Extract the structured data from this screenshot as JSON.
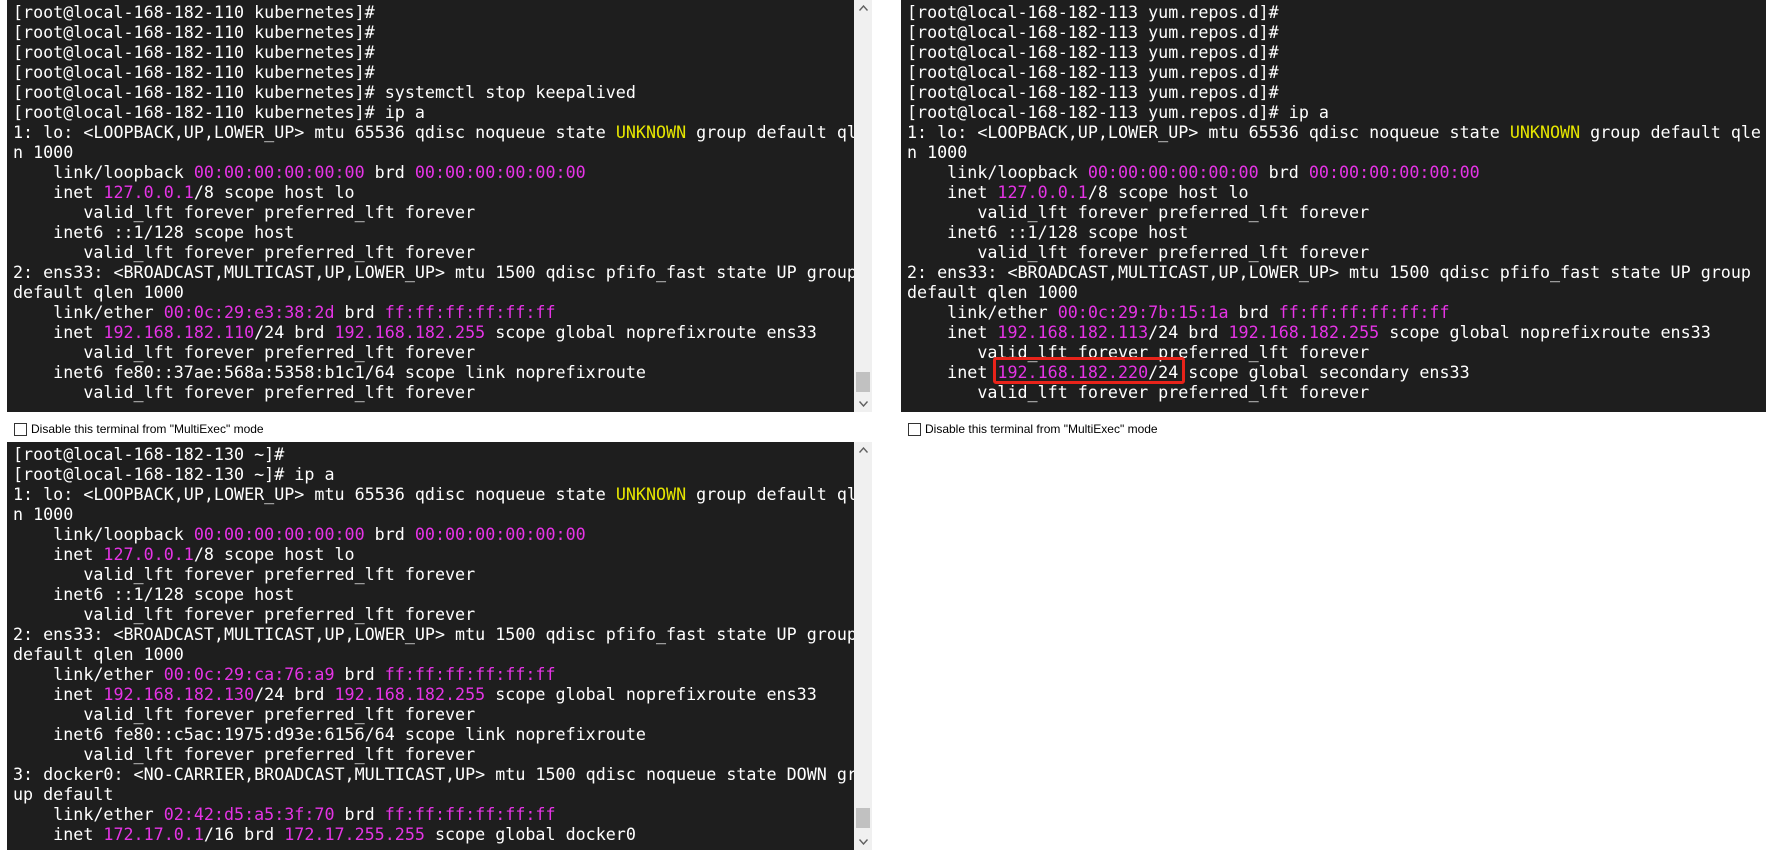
{
  "colors": {
    "terminal_bg": "#1e1e1e",
    "text": "#ffffff",
    "magenta": "#e534e5",
    "yellow": "#e5e500",
    "highlight": "#e8231a"
  },
  "terminals": [
    {
      "id": "top-left",
      "lines": [
        [
          {
            "t": "[root@local-168-182-110 kubernetes]#"
          }
        ],
        [
          {
            "t": "[root@local-168-182-110 kubernetes]#"
          }
        ],
        [
          {
            "t": "[root@local-168-182-110 kubernetes]#"
          }
        ],
        [
          {
            "t": "[root@local-168-182-110 kubernetes]#"
          }
        ],
        [
          {
            "t": "[root@local-168-182-110 kubernetes]# systemctl stop keepalived"
          }
        ],
        [
          {
            "t": "[root@local-168-182-110 kubernetes]# ip a"
          }
        ],
        [
          {
            "t": "1: lo: <LOOPBACK,UP,LOWER_UP> mtu 65536 qdisc noqueue state "
          },
          {
            "t": "UNKNOWN",
            "c": "yel"
          },
          {
            "t": " group default qle"
          }
        ],
        [
          {
            "t": "n 1000"
          }
        ],
        [
          {
            "t": "    link/loopback "
          },
          {
            "t": "00:00:00:00:00:00",
            "c": "mag"
          },
          {
            "t": " brd "
          },
          {
            "t": "00:00:00:00:00:00",
            "c": "mag"
          }
        ],
        [
          {
            "t": "    inet "
          },
          {
            "t": "127.0.0.1",
            "c": "mag"
          },
          {
            "t": "/8 scope host lo"
          }
        ],
        [
          {
            "t": "       valid_lft forever preferred_lft forever"
          }
        ],
        [
          {
            "t": "    inet6 ::1/128 scope host"
          }
        ],
        [
          {
            "t": "       valid_lft forever preferred_lft forever"
          }
        ],
        [
          {
            "t": "2: ens33: <BROADCAST,MULTICAST,UP,LOWER_UP> mtu 1500 qdisc pfifo_fast state UP group"
          }
        ],
        [
          {
            "t": "default qlen 1000"
          }
        ],
        [
          {
            "t": "    link/ether "
          },
          {
            "t": "00:0c:29:e3:38:2d",
            "c": "mag"
          },
          {
            "t": " brd "
          },
          {
            "t": "ff:ff:ff:ff:ff:ff",
            "c": "mag"
          }
        ],
        [
          {
            "t": "    inet "
          },
          {
            "t": "192.168.182.110",
            "c": "mag"
          },
          {
            "t": "/24 brd "
          },
          {
            "t": "192.168.182.255",
            "c": "mag"
          },
          {
            "t": " scope global noprefixroute ens33"
          }
        ],
        [
          {
            "t": "       valid_lft forever preferred_lft forever"
          }
        ],
        [
          {
            "t": "    inet6 fe80::37ae:568a:5358:b1c1/64 scope link noprefixroute"
          }
        ],
        [
          {
            "t": "       valid_lft forever preferred_lft forever"
          }
        ]
      ]
    },
    {
      "id": "top-right",
      "lines": [
        [
          {
            "t": "[root@local-168-182-113 yum.repos.d]#"
          }
        ],
        [
          {
            "t": "[root@local-168-182-113 yum.repos.d]#"
          }
        ],
        [
          {
            "t": "[root@local-168-182-113 yum.repos.d]#"
          }
        ],
        [
          {
            "t": "[root@local-168-182-113 yum.repos.d]#"
          }
        ],
        [
          {
            "t": "[root@local-168-182-113 yum.repos.d]#"
          }
        ],
        [
          {
            "t": "[root@local-168-182-113 yum.repos.d]# ip a"
          }
        ],
        [
          {
            "t": "1: lo: <LOOPBACK,UP,LOWER_UP> mtu 65536 qdisc noqueue state "
          },
          {
            "t": "UNKNOWN",
            "c": "yel"
          },
          {
            "t": " group default qle"
          }
        ],
        [
          {
            "t": "n 1000"
          }
        ],
        [
          {
            "t": "    link/loopback "
          },
          {
            "t": "00:00:00:00:00:00",
            "c": "mag"
          },
          {
            "t": " brd "
          },
          {
            "t": "00:00:00:00:00:00",
            "c": "mag"
          }
        ],
        [
          {
            "t": "    inet "
          },
          {
            "t": "127.0.0.1",
            "c": "mag"
          },
          {
            "t": "/8 scope host lo"
          }
        ],
        [
          {
            "t": "       valid_lft forever preferred_lft forever"
          }
        ],
        [
          {
            "t": "    inet6 ::1/128 scope host"
          }
        ],
        [
          {
            "t": "       valid_lft forever preferred_lft forever"
          }
        ],
        [
          {
            "t": "2: ens33: <BROADCAST,MULTICAST,UP,LOWER_UP> mtu 1500 qdisc pfifo_fast state UP group"
          }
        ],
        [
          {
            "t": "default qlen 1000"
          }
        ],
        [
          {
            "t": "    link/ether "
          },
          {
            "t": "00:0c:29:7b:15:1a",
            "c": "mag"
          },
          {
            "t": " brd "
          },
          {
            "t": "ff:ff:ff:ff:ff:ff",
            "c": "mag"
          }
        ],
        [
          {
            "t": "    inet "
          },
          {
            "t": "192.168.182.113",
            "c": "mag"
          },
          {
            "t": "/24 brd "
          },
          {
            "t": "192.168.182.255",
            "c": "mag"
          },
          {
            "t": " scope global noprefixroute ens33"
          }
        ],
        [
          {
            "t": "       valid_lft forever preferred_lft forever"
          }
        ],
        [
          {
            "t": "    inet "
          },
          {
            "t": "192.168.182.220",
            "c": "mag"
          },
          {
            "t": "/24 scope global secondary ens33"
          }
        ],
        [
          {
            "t": "       valid_lft forever preferred_lft forever"
          }
        ]
      ]
    },
    {
      "id": "bottom-left",
      "lines": [
        [
          {
            "t": "[root@local-168-182-130 ~]#"
          }
        ],
        [
          {
            "t": "[root@local-168-182-130 ~]# ip a"
          }
        ],
        [
          {
            "t": "1: lo: <LOOPBACK,UP,LOWER_UP> mtu 65536 qdisc noqueue state "
          },
          {
            "t": "UNKNOWN",
            "c": "yel"
          },
          {
            "t": " group default qle"
          }
        ],
        [
          {
            "t": "n 1000"
          }
        ],
        [
          {
            "t": "    link/loopback "
          },
          {
            "t": "00:00:00:00:00:00",
            "c": "mag"
          },
          {
            "t": " brd "
          },
          {
            "t": "00:00:00:00:00:00",
            "c": "mag"
          }
        ],
        [
          {
            "t": "    inet "
          },
          {
            "t": "127.0.0.1",
            "c": "mag"
          },
          {
            "t": "/8 scope host lo"
          }
        ],
        [
          {
            "t": "       valid_lft forever preferred_lft forever"
          }
        ],
        [
          {
            "t": "    inet6 ::1/128 scope host"
          }
        ],
        [
          {
            "t": "       valid_lft forever preferred_lft forever"
          }
        ],
        [
          {
            "t": "2: ens33: <BROADCAST,MULTICAST,UP,LOWER_UP> mtu 1500 qdisc pfifo_fast state UP group"
          }
        ],
        [
          {
            "t": "default qlen 1000"
          }
        ],
        [
          {
            "t": "    link/ether "
          },
          {
            "t": "00:0c:29:ca:76:a9",
            "c": "mag"
          },
          {
            "t": " brd "
          },
          {
            "t": "ff:ff:ff:ff:ff:ff",
            "c": "mag"
          }
        ],
        [
          {
            "t": "    inet "
          },
          {
            "t": "192.168.182.130",
            "c": "mag"
          },
          {
            "t": "/24 brd "
          },
          {
            "t": "192.168.182.255",
            "c": "mag"
          },
          {
            "t": " scope global noprefixroute ens33"
          }
        ],
        [
          {
            "t": "       valid_lft forever preferred_lft forever"
          }
        ],
        [
          {
            "t": "    inet6 fe80::c5ac:1975:d93e:6156/64 scope link noprefixroute"
          }
        ],
        [
          {
            "t": "       valid_lft forever preferred_lft forever"
          }
        ],
        [
          {
            "t": "3: docker0: <NO-CARRIER,BROADCAST,MULTICAST,UP> mtu 1500 qdisc noqueue state DOWN gro"
          }
        ],
        [
          {
            "t": "up default"
          }
        ],
        [
          {
            "t": "    link/ether "
          },
          {
            "t": "02:42:d5:a5:3f:70",
            "c": "mag"
          },
          {
            "t": " brd "
          },
          {
            "t": "ff:ff:ff:ff:ff:ff",
            "c": "mag"
          }
        ],
        [
          {
            "t": "    inet "
          },
          {
            "t": "172.17.0.1",
            "c": "mag"
          },
          {
            "t": "/16 brd "
          },
          {
            "t": "172.17.255.255",
            "c": "mag"
          },
          {
            "t": " scope global docker0"
          }
        ]
      ]
    }
  ],
  "multiexec": {
    "label": "Disable this terminal from \"MultiExec\" mode"
  }
}
